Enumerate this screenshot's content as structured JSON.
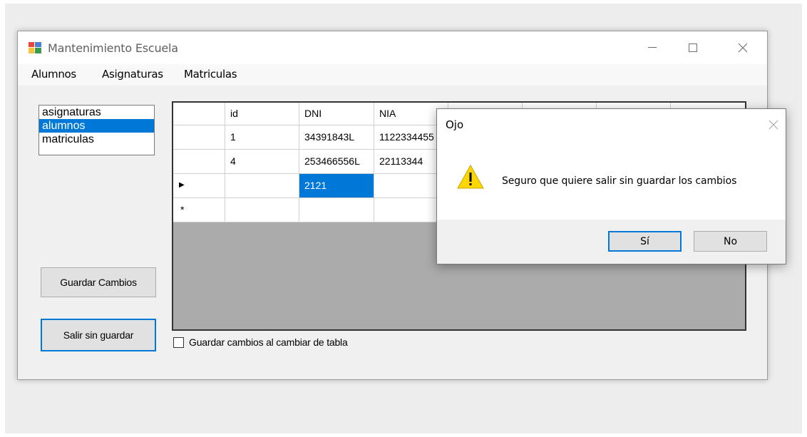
{
  "window": {
    "title": "Mantenimiento Escuela"
  },
  "menu": [
    "Alumnos",
    "Asignaturas",
    "Matriculas"
  ],
  "listbox": {
    "items": [
      "asignaturas",
      "alumnos",
      "matriculas"
    ],
    "selected_index": 1
  },
  "buttons": {
    "save_label": "Guardar Cambios",
    "exit_label": "Salir sin guardar"
  },
  "grid": {
    "columns": [
      "id",
      "DNI",
      "NIA",
      "",
      "",
      "",
      ""
    ],
    "rows": [
      {
        "marker": "",
        "cells": [
          "1",
          "34391843L",
          "1122334455",
          "",
          "",
          "",
          ""
        ]
      },
      {
        "marker": "",
        "cells": [
          "4",
          "253466556L",
          "22113344",
          "",
          "",
          "",
          ""
        ]
      },
      {
        "marker": "▶",
        "cells": [
          "",
          "2121",
          "",
          "",
          "",
          "",
          ""
        ]
      },
      {
        "marker": "*",
        "cells": [
          "",
          "",
          "",
          "",
          "",
          "",
          ""
        ]
      }
    ],
    "selected_cell": {
      "row": 2,
      "col": 1
    }
  },
  "checkbox": {
    "label": "Guardar cambios  al cambiar de tabla",
    "checked": false
  },
  "dialog": {
    "title": "Ojo",
    "message": "Seguro que quiere salir sin guardar los cambios",
    "icon": "warning-icon",
    "yes_label": "Sí",
    "no_label": "No"
  },
  "colors": {
    "accent": "#0078d7",
    "warning": "#ffd700"
  }
}
